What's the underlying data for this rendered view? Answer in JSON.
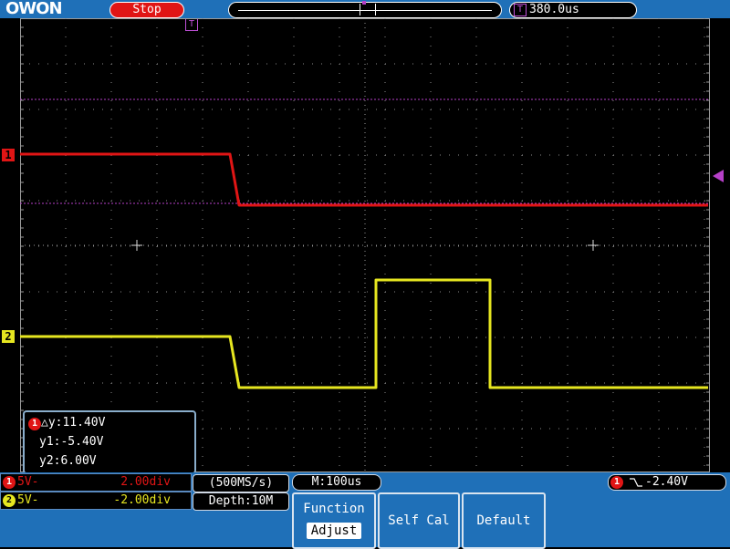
{
  "brand": {
    "logo": "OWON"
  },
  "status": {
    "run_state": "Stop"
  },
  "timebase": {
    "trigger_position": "380.0us"
  },
  "channels": [
    {
      "id": "1",
      "coupling": "5V-",
      "scale": "2.00div",
      "color": "#e01515"
    },
    {
      "id": "2",
      "coupling": "5V-",
      "scale": "-2.00div",
      "color": "#e6e620"
    }
  ],
  "acquisition": {
    "sample_rate": "(500MS/s)",
    "depth": "Depth:10M"
  },
  "horizontal": {
    "main": "M:100us"
  },
  "trigger": {
    "source": "1",
    "level": "-2.40V",
    "marker_label": "T"
  },
  "cursors": {
    "source": "1",
    "delta_y": "△y:11.40V",
    "y1": "y1:-5.40V",
    "y2": "y2:6.00V"
  },
  "menu": {
    "function_line1": "Function",
    "function_line2": "Adjust",
    "self_cal": "Self Cal",
    "default": "Default"
  },
  "waveforms": {
    "ch1": [
      {
        "t_div": 0.0,
        "level": "high"
      },
      {
        "t_div": 4.6,
        "level": "high"
      },
      {
        "t_div": 4.8,
        "level": "low"
      },
      {
        "t_div": 15.1,
        "level": "low"
      }
    ],
    "ch2": [
      {
        "t_div": 0.0,
        "level": "high"
      },
      {
        "t_div": 4.6,
        "level": "high"
      },
      {
        "t_div": 4.8,
        "level": "low"
      },
      {
        "t_div": 7.8,
        "level": "low"
      },
      {
        "t_div": 7.8,
        "level": "pulse"
      },
      {
        "t_div": 10.3,
        "level": "pulse"
      },
      {
        "t_div": 10.3,
        "level": "low"
      },
      {
        "t_div": 15.1,
        "level": "low"
      }
    ]
  },
  "colors": {
    "ui_blue": "#1f70b8",
    "ch1": "#e01515",
    "ch2": "#e6e620",
    "trigger": "#b640c8"
  }
}
